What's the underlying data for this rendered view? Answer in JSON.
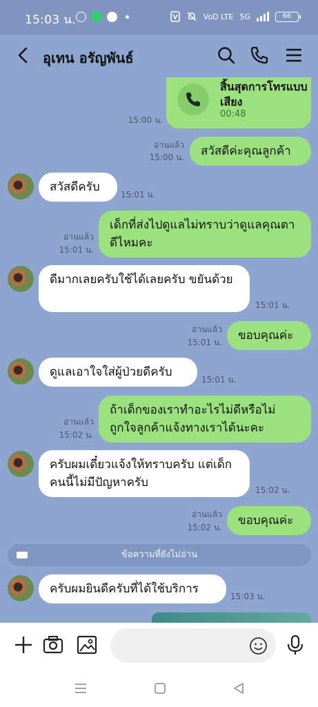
{
  "status": {
    "time": "15:03 น.",
    "network_label": "VoD LTE",
    "signal_label": "5G",
    "battery": "66"
  },
  "header": {
    "contact_name": "อุเทน อรัญพันธ์",
    "icons": [
      "back-icon",
      "search-icon",
      "phone-icon",
      "menu-icon"
    ]
  },
  "messages": [
    {
      "type": "call",
      "side": "out",
      "text": "สิ้นสุดการโทรแบบเสียง",
      "duration": "00:48",
      "time": "15:00 น."
    },
    {
      "side": "out",
      "text": "สวัสดีค่ะคุณลูกค้า",
      "read": "อ่านแล้ว",
      "time": "15:00 น."
    },
    {
      "side": "in",
      "text": "สวัสดีครับ",
      "time": "15:01 น."
    },
    {
      "side": "out",
      "text": "เด็กที่ส่งไปดูแลไม่ทราบว่าดูแลคุณตาดีไหมคะ",
      "read": "อ่านแล้ว",
      "time": "15:01 น."
    },
    {
      "side": "in",
      "text": "ดีมากเลยครับใช้ได้เลยครับ ขยันด้วย",
      "time": "15:01 น."
    },
    {
      "side": "out",
      "text": "ขอบคุณค่ะ",
      "read": "อ่านแล้ว",
      "time": "15:01 น."
    },
    {
      "side": "in",
      "text": "ดูแลเอาใจใส่ผู้ป่วยดีครับ",
      "time": "15:01 น."
    },
    {
      "side": "out",
      "text": "ถ้าเด็กของเราทำอะไรไม่ดีหรือไม่ถูกใจลูกค้าแจ้งทางเราได้นะคะ",
      "read": "อ่านแล้ว",
      "time": "15:02 น."
    },
    {
      "side": "in",
      "text": "ครับผมเดี๋ยวแจ้งให้ทราบครับ แต่เด็กคนนี้ไม่มีปัญหาครับ",
      "time": "15:02 น."
    },
    {
      "side": "out",
      "text": "ขอบคุณค่ะ",
      "read": "อ่านแล้ว",
      "time": "15:02 น."
    },
    {
      "side": "in",
      "text": "ครับผมยินดีครับที่ได้ใช้บริการ",
      "time": "15:03 น."
    }
  ],
  "unread_divider": "ข้อความที่ยังไม่อ่าน",
  "input": {
    "icons": [
      "plus-icon",
      "camera-icon",
      "image-icon",
      "emoji-icon",
      "mic-icon"
    ]
  },
  "colors": {
    "background": "#8ea5cf",
    "outgoing_bubble": "#9be27e",
    "incoming_bubble": "#ffffff",
    "status_bar": "#7f95c0"
  }
}
